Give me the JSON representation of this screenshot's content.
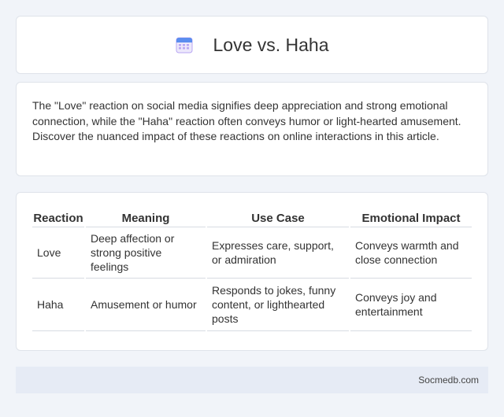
{
  "header": {
    "title": "Love vs. Haha",
    "icon": "calendar-icon"
  },
  "intro": {
    "text": "The \"Love\" reaction on social media signifies deep appreciation and strong emotional connection, while the \"Haha\" reaction often conveys humor or light-hearted amusement. Discover the nuanced impact of these reactions on online interactions in this article."
  },
  "table": {
    "headers": [
      "Reaction",
      "Meaning",
      "Use Case",
      "Emotional Impact"
    ],
    "rows": [
      [
        "Love",
        "Deep affection or strong positive feelings",
        "Expresses care, support, or admiration",
        "Conveys warmth and close connection"
      ],
      [
        "Haha",
        "Amusement or humor",
        "Responds to jokes, funny content, or lighthearted posts",
        "Conveys joy and entertainment"
      ]
    ]
  },
  "footer": {
    "site": "Socmedb.com"
  },
  "colors": {
    "page_bg": "#f1f4f9",
    "card_bg": "#ffffff",
    "footer_bg": "#e6ebf5",
    "icon_blue": "#5b8def",
    "icon_purple": "#b9a7f3"
  }
}
